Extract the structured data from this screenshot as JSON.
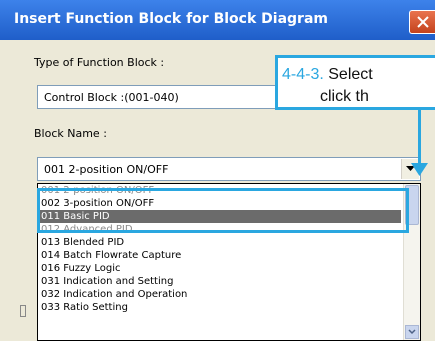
{
  "window": {
    "title": "Insert Function Block for Block Diagram"
  },
  "form": {
    "type_label": "Type of Function Block :",
    "type_value": "Control Block :(001-040)",
    "name_label": "Block Name :",
    "name_value": "001  2-position ON/OFF"
  },
  "callout": {
    "step": "4-4-3.",
    "line1": " Select",
    "line2": "click th"
  },
  "dropdown": {
    "items": [
      "001  2-position ON/OFF",
      "002  3-position ON/OFF",
      "011  Basic PID",
      "012  Advanced PID",
      "013  Blended PID",
      "014  Batch Flowrate Capture",
      "016  Fuzzy Logic",
      "031  Indication and Setting",
      "032  Indication and Operation",
      "033  Ratio Setting"
    ],
    "selected_index": 2
  },
  "colors": {
    "accent": "#2aa7e0",
    "titlebar": "#2f6fd9",
    "selection": "#6b6b6b"
  }
}
